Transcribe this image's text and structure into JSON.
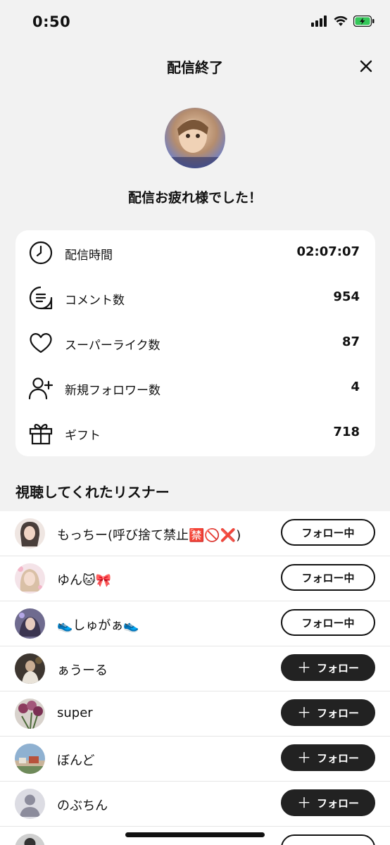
{
  "status": {
    "time": "0:50"
  },
  "header": {
    "title": "配信終了"
  },
  "thanks": "配信お疲れ様でした！",
  "stats": [
    {
      "icon": "clock-icon",
      "label": "配信時間",
      "value": "02:07:07"
    },
    {
      "icon": "comment-icon",
      "label": "コメント数",
      "value": "954"
    },
    {
      "icon": "heart-icon",
      "label": "スーパーライク数",
      "value": "87"
    },
    {
      "icon": "add-user-icon",
      "label": "新規フォロワー数",
      "value": "4"
    },
    {
      "icon": "gift-icon",
      "label": "ギフト",
      "value": "718"
    }
  ],
  "listeners_title": "視聴してくれたリスナー",
  "buttons": {
    "following": "フォロー中",
    "follow": "フォロー"
  },
  "listeners": [
    {
      "name": "もっちー(呼び捨て禁止🈲🚫❌)",
      "state": "following",
      "avatar_color": "#6b5a52"
    },
    {
      "name": "ゆん🐱🎀",
      "state": "following",
      "avatar_color": "#e6cfd4"
    },
    {
      "name": "👟しゅがぁ👟",
      "state": "following",
      "avatar_color": "#8b7fa6"
    },
    {
      "name": "ぁうーる",
      "state": "follow",
      "avatar_color": "#4e4338"
    },
    {
      "name": "super",
      "state": "follow",
      "avatar_color": "#7c5a6e"
    },
    {
      "name": "ぼんど",
      "state": "follow",
      "avatar_color": "#8aa3b8"
    },
    {
      "name": "のぶちん",
      "state": "follow",
      "avatar_color": "#d6d6de"
    },
    {
      "name": "",
      "state": "follow",
      "avatar_color": "#444444"
    }
  ],
  "colors": {
    "background": "#f2f2f2",
    "card": "#ffffff",
    "accent": "#222222",
    "battery": "#34c759"
  }
}
